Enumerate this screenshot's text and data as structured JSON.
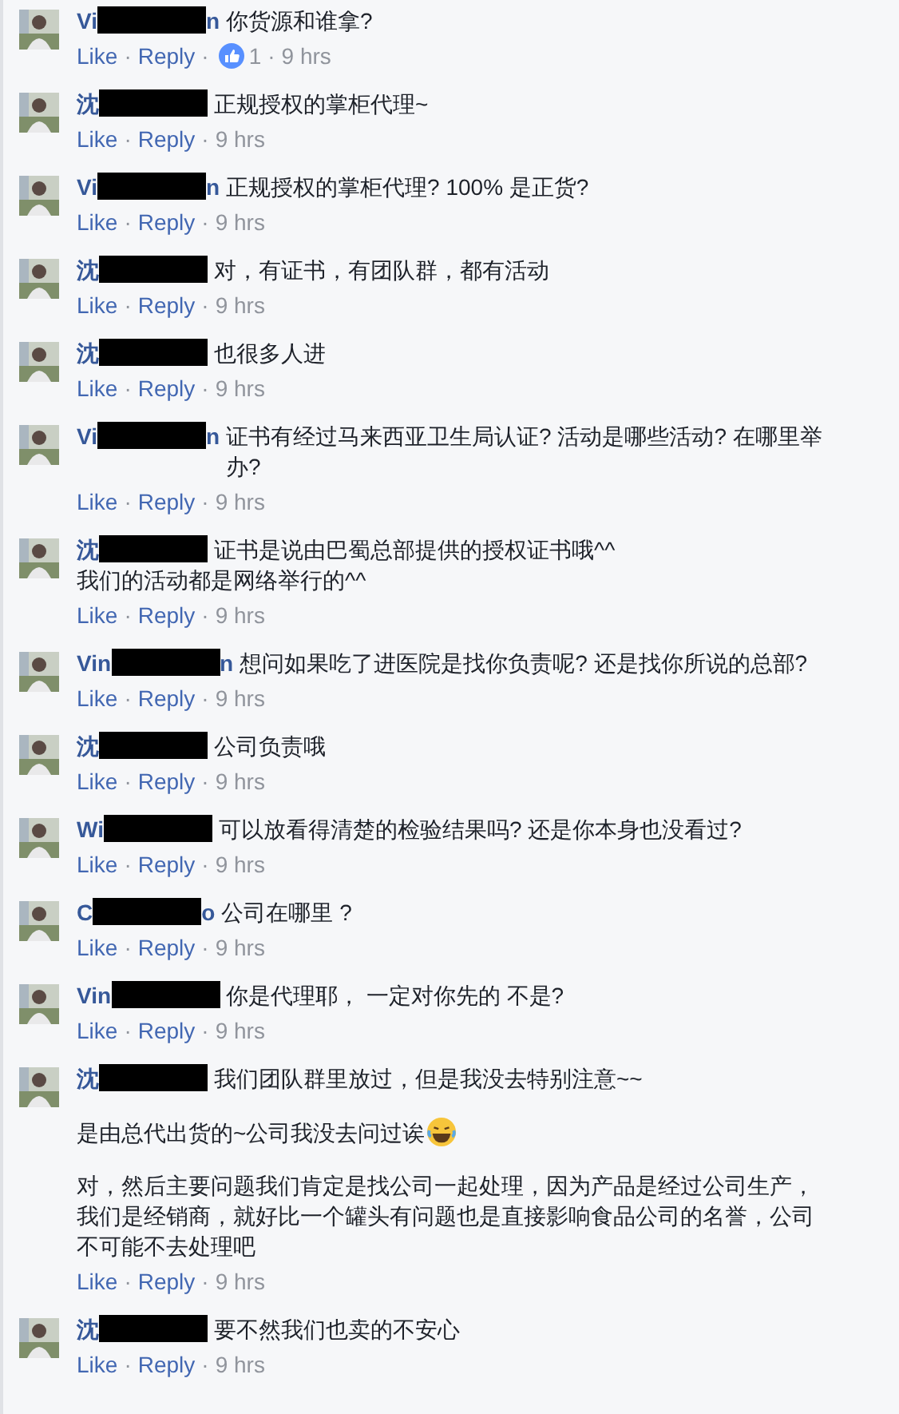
{
  "comments": [
    {
      "name": "Vi",
      "name_end": "n",
      "paragraphs": [
        {
          "text": "你货源和谁拿?",
          "emoji": false
        }
      ],
      "meta": [
        {
          "kind": "link",
          "text": "Like"
        },
        {
          "kind": "separator",
          "text": "·"
        },
        {
          "kind": "link",
          "text": "Reply"
        },
        {
          "kind": "separator",
          "text": "·"
        },
        {
          "kind": "likes",
          "text": "1"
        },
        {
          "kind": "separator",
          "text": "·"
        },
        {
          "kind": "time",
          "text": "9 hrs"
        }
      ]
    },
    {
      "name": "沈",
      "paragraphs": [
        {
          "text": "正规授权的掌柜代理~",
          "emoji": false
        }
      ],
      "meta": [
        {
          "kind": "link",
          "text": "Like"
        },
        {
          "kind": "separator",
          "text": "·"
        },
        {
          "kind": "link",
          "text": "Reply"
        },
        {
          "kind": "separator",
          "text": "·"
        },
        {
          "kind": "time",
          "text": "9 hrs"
        }
      ]
    },
    {
      "name": "Vi",
      "name_end": "n",
      "paragraphs": [
        {
          "text": "正规授权的掌柜代理? 100% 是正货?",
          "emoji": false
        }
      ],
      "meta": [
        {
          "kind": "link",
          "text": "Like"
        },
        {
          "kind": "separator",
          "text": "·"
        },
        {
          "kind": "link",
          "text": "Reply"
        },
        {
          "kind": "separator",
          "text": "·"
        },
        {
          "kind": "time",
          "text": "9 hrs"
        }
      ]
    },
    {
      "name": "沈",
      "paragraphs": [
        {
          "text": "对，有证书，有团队群，都有活动",
          "emoji": false
        }
      ],
      "meta": [
        {
          "kind": "link",
          "text": "Like"
        },
        {
          "kind": "separator",
          "text": "·"
        },
        {
          "kind": "link",
          "text": "Reply"
        },
        {
          "kind": "separator",
          "text": "·"
        },
        {
          "kind": "time",
          "text": "9 hrs"
        }
      ]
    },
    {
      "name": "沈",
      "paragraphs": [
        {
          "text": "也很多人进",
          "emoji": false
        }
      ],
      "meta": [
        {
          "kind": "link",
          "text": "Like"
        },
        {
          "kind": "separator",
          "text": "·"
        },
        {
          "kind": "link",
          "text": "Reply"
        },
        {
          "kind": "separator",
          "text": "·"
        },
        {
          "kind": "time",
          "text": "9 hrs"
        }
      ]
    },
    {
      "name": "Vi",
      "name_end": "n",
      "paragraphs": [
        {
          "text": "证书有经过马来西亚卫生局认证? 活动是哪些活动? 在哪里举办?",
          "emoji": false
        }
      ],
      "meta": [
        {
          "kind": "link",
          "text": "Like"
        },
        {
          "kind": "separator",
          "text": "·"
        },
        {
          "kind": "link",
          "text": "Reply"
        },
        {
          "kind": "separator",
          "text": "·"
        },
        {
          "kind": "time",
          "text": "9 hrs"
        }
      ]
    },
    {
      "name": "沈",
      "paragraphs": [
        {
          "text": "证书是说由巴蜀总部提供的授权证书哦^^",
          "emoji": false
        },
        {
          "text": "我们的活动都是网络举行的^^",
          "emoji": false
        }
      ],
      "meta": [
        {
          "kind": "link",
          "text": "Like"
        },
        {
          "kind": "separator",
          "text": "·"
        },
        {
          "kind": "link",
          "text": "Reply"
        },
        {
          "kind": "separator",
          "text": "·"
        },
        {
          "kind": "time",
          "text": "9 hrs"
        }
      ]
    },
    {
      "name": "Vin",
      "name_end": "n",
      "paragraphs": [
        {
          "text": "想问如果吃了进医院是找你负责呢? 还是找你所说的总部?",
          "emoji": false
        }
      ],
      "meta": [
        {
          "kind": "link",
          "text": "Like"
        },
        {
          "kind": "separator",
          "text": "·"
        },
        {
          "kind": "link",
          "text": "Reply"
        },
        {
          "kind": "separator",
          "text": "·"
        },
        {
          "kind": "time",
          "text": "9 hrs"
        }
      ]
    },
    {
      "name": "沈",
      "paragraphs": [
        {
          "text": "公司负责哦",
          "emoji": false
        }
      ],
      "meta": [
        {
          "kind": "link",
          "text": "Like"
        },
        {
          "kind": "separator",
          "text": "·"
        },
        {
          "kind": "link",
          "text": "Reply"
        },
        {
          "kind": "separator",
          "text": "·"
        },
        {
          "kind": "time",
          "text": "9 hrs"
        }
      ]
    },
    {
      "name": "Wi",
      "paragraphs": [
        {
          "text": "可以放看得清楚的检验结果吗? 还是你本身也没看过?",
          "emoji": false
        }
      ],
      "meta": [
        {
          "kind": "link",
          "text": "Like"
        },
        {
          "kind": "separator",
          "text": "·"
        },
        {
          "kind": "link",
          "text": "Reply"
        },
        {
          "kind": "separator",
          "text": "·"
        },
        {
          "kind": "time",
          "text": "9 hrs"
        }
      ]
    },
    {
      "name": "C",
      "name_end": "o",
      "paragraphs": [
        {
          "text": "公司在哪里 ?",
          "emoji": false
        }
      ],
      "meta": [
        {
          "kind": "link",
          "text": "Like"
        },
        {
          "kind": "separator",
          "text": "·"
        },
        {
          "kind": "link",
          "text": "Reply"
        },
        {
          "kind": "separator",
          "text": "·"
        },
        {
          "kind": "time",
          "text": "9 hrs"
        }
      ]
    },
    {
      "name": "Vin",
      "paragraphs": [
        {
          "text": "你是代理耶， 一定对你先的 不是?",
          "emoji": false
        }
      ],
      "meta": [
        {
          "kind": "link",
          "text": "Like"
        },
        {
          "kind": "separator",
          "text": "·"
        },
        {
          "kind": "link",
          "text": "Reply"
        },
        {
          "kind": "separator",
          "text": "·"
        },
        {
          "kind": "time",
          "text": "9 hrs"
        }
      ]
    },
    {
      "name": "沈",
      "paragraphs": [
        {
          "text": "我们团队群里放过，但是我没去特别注意~~",
          "emoji": false
        },
        {
          "text": "是由总代出货的~公司我没去问过诶",
          "emoji": true
        },
        {
          "text": "对，然后主要问题我们肯定是找公司一起处理，因为产品是经过公司生产，我们是经销商，就好比一个罐头有问题也是直接影响食品公司的名誉，公司不可能不去处理吧",
          "emoji": false
        }
      ],
      "meta": [
        {
          "kind": "link",
          "text": "Like"
        },
        {
          "kind": "separator",
          "text": "·"
        },
        {
          "kind": "link",
          "text": "Reply"
        },
        {
          "kind": "separator",
          "text": "·"
        },
        {
          "kind": "time",
          "text": "9 hrs"
        }
      ]
    },
    {
      "name": "沈",
      "paragraphs": [
        {
          "text": "要不然我们也卖的不安心",
          "emoji": false
        }
      ],
      "meta": [
        {
          "kind": "link",
          "text": "Like"
        },
        {
          "kind": "separator",
          "text": "·"
        },
        {
          "kind": "link",
          "text": "Reply"
        },
        {
          "kind": "separator",
          "text": "·"
        },
        {
          "kind": "time",
          "text": "9 hrs"
        }
      ]
    }
  ]
}
